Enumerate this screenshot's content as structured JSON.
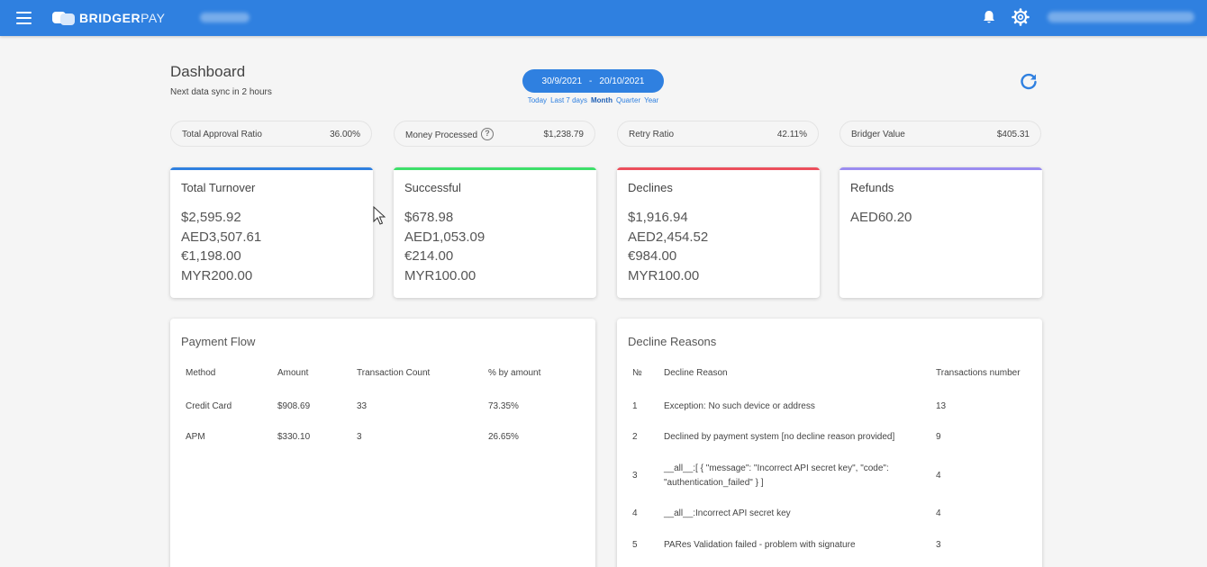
{
  "topbar": {
    "brand_bold": "BRIDGER",
    "brand_light": "PAY",
    "icons": [
      "menu-icon",
      "bell-icon",
      "gear-icon"
    ]
  },
  "header": {
    "title": "Dashboard",
    "subtitle": "Next data sync in 2 hours",
    "date_from": "30/9/2021",
    "date_separator": "-",
    "date_to": "20/10/2021",
    "quick_ranges": [
      "Today",
      "Last 7 days",
      "Month",
      "Quarter",
      "Year"
    ],
    "active_range": "Month"
  },
  "summary": [
    {
      "label": "Total Approval Ratio",
      "value": "36.00%"
    },
    {
      "label": "Money Processed",
      "value": "$1,238.79"
    },
    {
      "label": "Retry Ratio",
      "value": "42.11%"
    },
    {
      "label": "Bridger Value",
      "value": "$405.31"
    }
  ],
  "cards": [
    {
      "title": "Total Turnover",
      "color": "#2f80e0",
      "values": [
        "$2,595.92",
        "AED3,507.61",
        "€1,198.00",
        "MYR200.00"
      ]
    },
    {
      "title": "Successful",
      "color": "#3ee06a",
      "values": [
        "$678.98",
        "AED1,053.09",
        "€214.00",
        "MYR100.00"
      ]
    },
    {
      "title": "Declines",
      "color": "#ec4f5c",
      "values": [
        "$1,916.94",
        "AED2,454.52",
        "€984.00",
        "MYR100.00"
      ]
    },
    {
      "title": "Refunds",
      "color": "#9b8cf0",
      "values": [
        "AED60.20"
      ]
    }
  ],
  "payment_flow": {
    "title": "Payment Flow",
    "columns": [
      "Method",
      "Amount",
      "Transaction Count",
      "% by amount"
    ],
    "rows": [
      [
        "Credit Card",
        "$908.69",
        "33",
        "73.35%"
      ],
      [
        "APM",
        "$330.10",
        "3",
        "26.65%"
      ]
    ]
  },
  "decline_reasons": {
    "title": "Decline Reasons",
    "columns": [
      "№",
      "Decline Reason",
      "Transactions number"
    ],
    "rows": [
      {
        "n": "1",
        "reason": "Exception: No such device or address",
        "count": "13"
      },
      {
        "n": "2",
        "reason": "Declined by payment system [no decline reason provided]",
        "count": "9"
      },
      {
        "n": "3",
        "reason_line1": "__all__:[ { \"message\": \"Incorrect API secret key\", \"code\":",
        "reason_line2": "\"authentication_failed\" } ]",
        "count": "4"
      },
      {
        "n": "4",
        "reason": "__all__:Incorrect API secret key",
        "count": "4"
      },
      {
        "n": "5",
        "reason": "PARes Validation failed - problem with signature",
        "count": "3"
      }
    ]
  }
}
